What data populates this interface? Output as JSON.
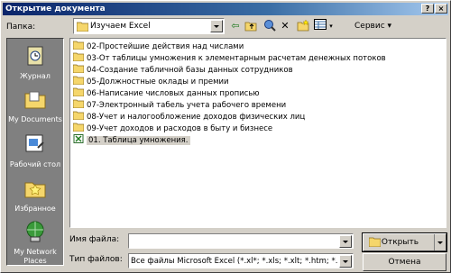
{
  "window": {
    "title": "Открытие документа",
    "help_glyph": "?",
    "close_glyph": "×"
  },
  "toolbar": {
    "folder_label": "Папка:",
    "folder_value": "Изучаем Excel",
    "back_glyph": "⇦",
    "up_glyph": "⤴",
    "search_web_glyph": "🔍",
    "delete_glyph": "✕",
    "new_folder_glyph": "📁",
    "views_glyph": "▦",
    "service_label": "Сервис ▾"
  },
  "places": [
    {
      "label": "Журнал"
    },
    {
      "label": "My Documents"
    },
    {
      "label": "Рабочий стол"
    },
    {
      "label": "Избранное"
    },
    {
      "label": "My Network Places"
    }
  ],
  "files": [
    {
      "name": "02-Простейшие действия над числами",
      "type": "folder"
    },
    {
      "name": "03-От таблицы умножения к элементарным расчетам денежных потоков",
      "type": "folder"
    },
    {
      "name": "04-Создание табличной базы данных сотрудников",
      "type": "folder"
    },
    {
      "name": "05-Должностные оклады и премии",
      "type": "folder"
    },
    {
      "name": "06-Написание числовых данных прописью",
      "type": "folder"
    },
    {
      "name": "07-Электронный табель учета рабочего времени",
      "type": "folder"
    },
    {
      "name": "08-Учет и налогообложение доходов физических лиц",
      "type": "folder"
    },
    {
      "name": "09-Учет доходов и расходов в быту и бизнесе",
      "type": "folder"
    },
    {
      "name": "01. Таблица умножения.",
      "type": "excel"
    }
  ],
  "filename": {
    "label": "Имя файла:",
    "value": ""
  },
  "filetype": {
    "label": "Тип файлов:",
    "value": "Все файлы Microsoft Excel (*.xl*; *.xls; *.xlt; *.htm; *.html; *"
  },
  "buttons": {
    "open": "Открыть",
    "cancel": "Отмена"
  },
  "colors": {
    "titlebar_start": "#0a246a",
    "titlebar_end": "#a6caf0",
    "face": "#d4d0c8",
    "folder": "#f5d66b"
  }
}
